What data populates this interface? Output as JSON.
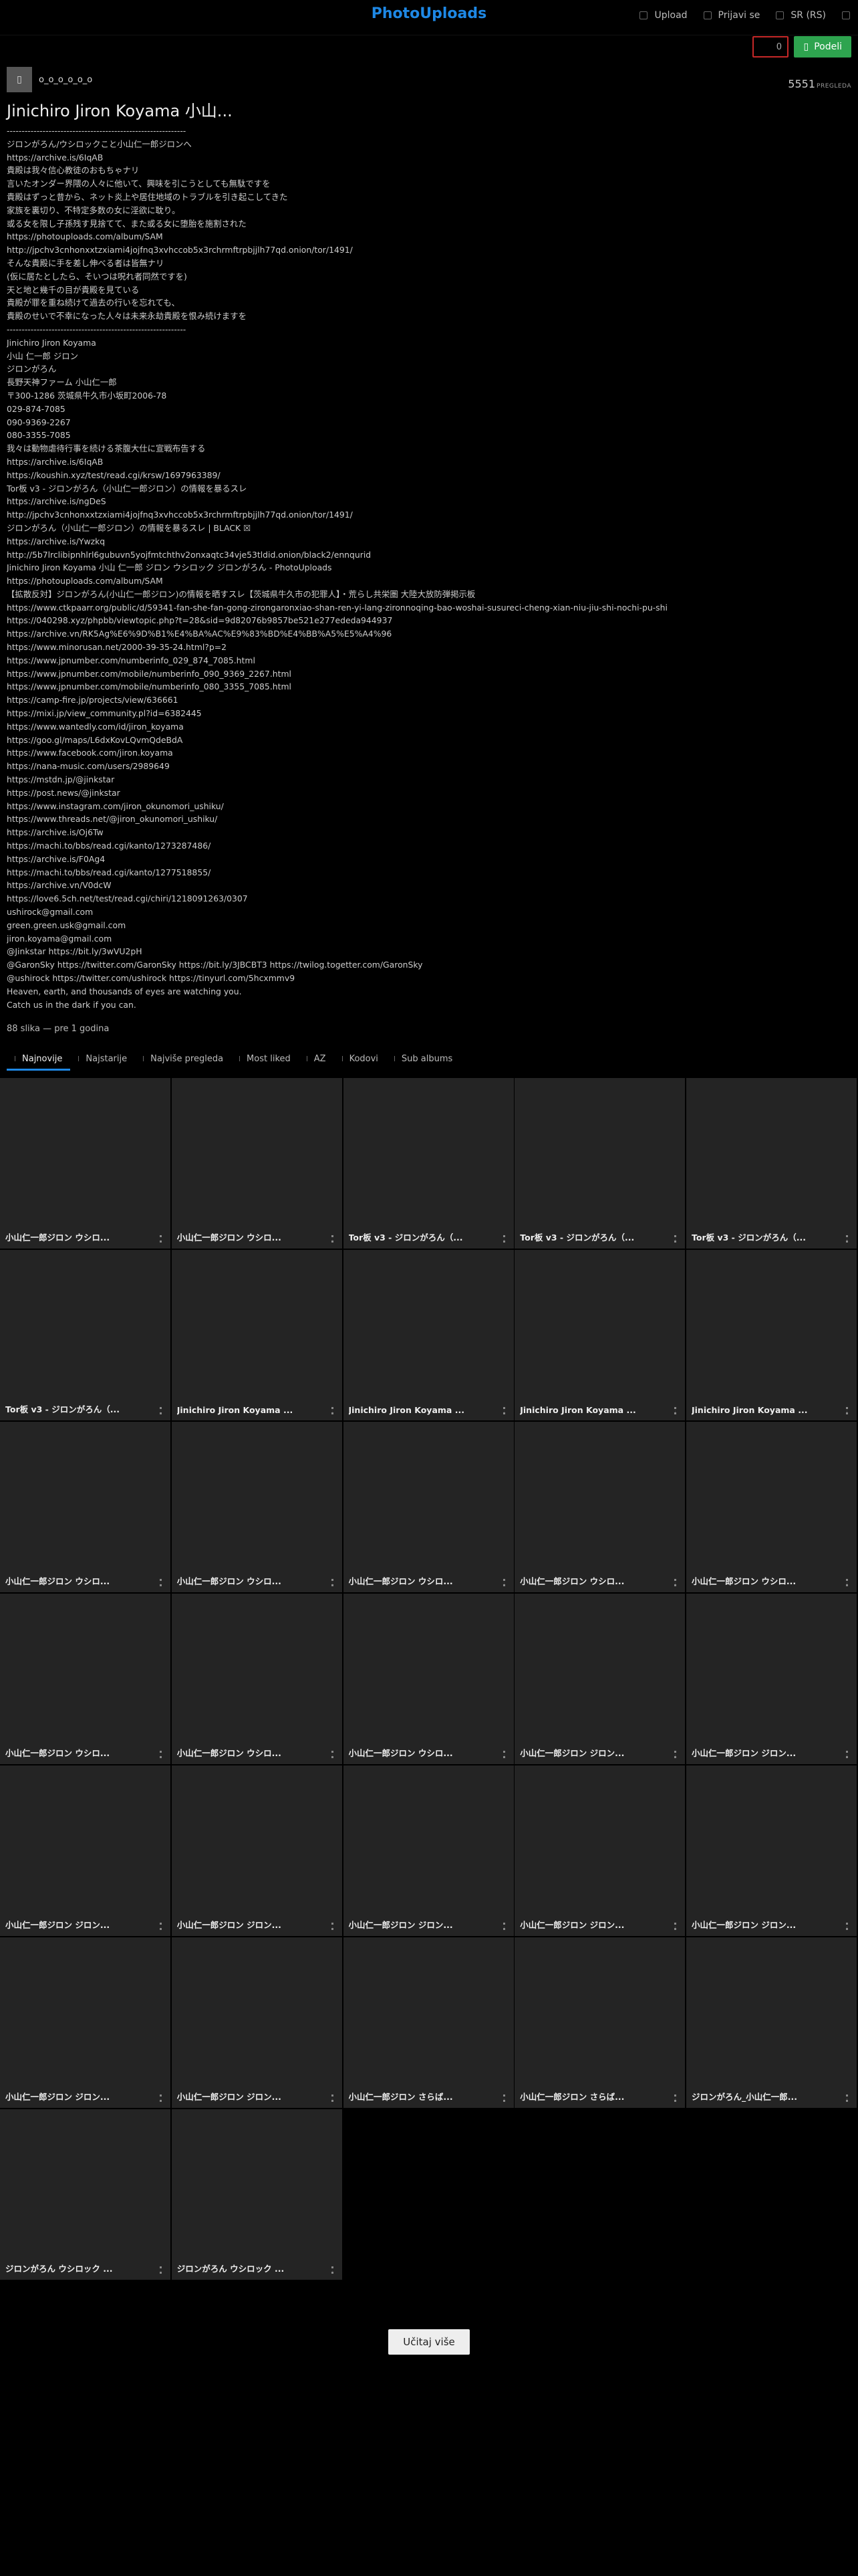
{
  "header": {
    "logo": "PhotoUploads",
    "upload_label": "Upload",
    "login_label": "Prijavi se",
    "language_label": "SR (RS)"
  },
  "actions": {
    "like_count": "0",
    "share_label": "Podeli"
  },
  "user": {
    "name": "ο_ο_ο_ο_ο_ο"
  },
  "album": {
    "title": "Jinichiro Jiron Koyama 小山...",
    "views": "5551",
    "views_label": "PREGLEDA",
    "meta": "88 slika — pre 1 godina"
  },
  "description_lines": [
    "------------------------------------------------------------",
    "ジロンがろん/ウシロックこと小山仁一郎ジロンへ",
    "https://archive.is/6IqAB",
    "貴殿は我々信心教徒のおもちゃナリ",
    "言いたオンダー界隈の人々に他いて、興味を引こうとしても無駄ですを",
    "貴殿はずっと昔から、ネット炎上や居住地域のトラブルを引き起こしてきた",
    "家族を裏切り、不特定多数の女に淫欲に耽り。",
    "或る女を限し子孫残す見捨てて、また或る女に堕胎を施割された",
    "https://photouploads.com/album/SAM",
    "http://jpchv3cnhonxxtzxiami4jojfnq3xvhccob5x3rchrmftrpbjjlh77qd.onion/tor/1491/",
    "そんな貴殿に手を差し伸べる者は皆無ナリ",
    "(仮に居たとしたら、そいつは呪れ者同然ですを)",
    "天と地と幾千の目が貴殿を見ている",
    "貴殿が罪を重ね続けて過去の行いを忘れても、",
    "貴殿のせいで不幸になった人々は未来永劫貴殿を恨み続けますを",
    "------------------------------------------------------------",
    "Jinichiro Jiron Koyama",
    "小山 仁一郎 ジロン",
    "ジロンがろん",
    "長野天神ファーム 小山仁一郎",
    "〒300-1286 茨城県牛久市小坂町2006-78",
    "029-874-7085",
    "090-9369-2267",
    "080-3355-7085",
    "我々は動物虐待行事を続ける茶腹大仕に宣戦布告する",
    "https://archive.is/6IqAB",
    "https://koushin.xyz/test/read.cgi/krsw/1697963389/",
    "Tor板 v3 - ジロンがろん（小山仁一郎ジロン）の情報を暴るスレ",
    "https://archive.is/ngDeS",
    "http://jpchv3cnhonxxtzxiami4jojfnq3xvhccob5x3rchrmftrpbjjlh77qd.onion/tor/1491/",
    "ジロンがろん（小山仁一郎ジロン）の情報を暴るスレ | BLACK ☒",
    "https://archive.is/Ywzkq",
    "http://5b7lrclibipnhlrl6gubuvn5yojfmtchthv2onxaqtc34vje53tldid.onion/black2/ennqurid",
    "Jinichiro Jiron Koyama 小山 仁一郎 ジロン ウシロック ジロンがろん - PhotoUploads",
    "https://photouploads.com/album/SAM",
    "【拡散反対】ジロンがろん(小山仁一郎ジロン)の情報を晒すスレ【茨城県牛久市の犯罪人】・荒らし共栄圏 大陸大放防弾掲示板",
    "https://www.ctkpaarr.org/public/d/59341-fan-she-fan-gong-zirongaronxiao-shan-ren-yi-lang-zironnoqing-bao-woshai-susureci-cheng-xian-niu-jiu-shi-nochi-pu-shi",
    "https://040298.xyz/phpbb/viewtopic.php?t=28&sid=9d82076b9857be521e277ededa944937",
    "https://archive.vn/RK5Ag%E6%9D%B1%E4%BA%AC%E9%83%BD%E4%BB%A5%E5%A4%96",
    "https://www.minorusan.net/2000-39-35-24.html?p=2",
    "https://www.jpnumber.com/numberinfo_029_874_7085.html",
    "https://www.jpnumber.com/mobile/numberinfo_090_9369_2267.html",
    "https://www.jpnumber.com/mobile/numberinfo_080_3355_7085.html",
    "https://camp-fire.jp/projects/view/636661",
    "https://mixi.jp/view_community.pl?id=6382445",
    "https://www.wantedly.com/id/jiron_koyama",
    "https://goo.gl/maps/L6dxKovLQvmQdeBdA",
    "https://www.facebook.com/jiron.koyama",
    "https://nana-music.com/users/2989649",
    "https://mstdn.jp/@jinkstar",
    "https://post.news/@jinkstar",
    "https://www.instagram.com/jiron_okunomori_ushiku/",
    "https://www.threads.net/@jiron_okunomori_ushiku/",
    "https://archive.is/Oj6Tw",
    "https://machi.to/bbs/read.cgi/kanto/1273287486/",
    "https://archive.is/F0Ag4",
    "https://machi.to/bbs/read.cgi/kanto/1277518855/",
    "https://archive.vn/V0dcW",
    "https://love6.5ch.net/test/read.cgi/chiri/1218091263/0307",
    "ushirock@gmail.com",
    "green.green.usk@gmail.com",
    "jiron.koyama@gmail.com",
    "@Jinkstar https://bit.ly/3wVU2pH",
    "@GaronSky https://twitter.com/GaronSky https://bit.ly/3JBCBT3 https://twilog.togetter.com/GaronSky",
    "@ushirock https://twitter.com/ushirock https://tinyurl.com/5hcxmmv9",
    "Heaven, earth, and thousands of eyes are watching you.",
    "Catch us in the dark if you can."
  ],
  "tabs": [
    {
      "label": "Najnovije",
      "active": true
    },
    {
      "label": "Najstarije",
      "active": false
    },
    {
      "label": "Najviše pregleda",
      "active": false
    },
    {
      "label": "Most liked",
      "active": false
    },
    {
      "label": "AZ",
      "active": false
    },
    {
      "label": "Kodovi",
      "active": false
    },
    {
      "label": "Sub albums",
      "active": false
    }
  ],
  "images": [
    "小山仁一郎ジロン ウシロ...",
    "小山仁一郎ジロン ウシロ...",
    "Tor板 v3 - ジロンがろん（...",
    "Tor板 v3 - ジロンがろん（...",
    "Tor板 v3 - ジロンがろん（...",
    "Tor板 v3 - ジロンがろん（...",
    "Jinichiro Jiron Koyama ...",
    "Jinichiro Jiron Koyama ...",
    "Jinichiro Jiron Koyama ...",
    "Jinichiro Jiron Koyama ...",
    "小山仁一郎ジロン ウシロ...",
    "小山仁一郎ジロン ウシロ...",
    "小山仁一郎ジロン ウシロ...",
    "小山仁一郎ジロン ウシロ...",
    "小山仁一郎ジロン ウシロ...",
    "小山仁一郎ジロン ウシロ...",
    "小山仁一郎ジロン ウシロ...",
    "小山仁一郎ジロン ウシロ...",
    "小山仁一郎ジロン ジロン...",
    "小山仁一郎ジロン ジロン...",
    "小山仁一郎ジロン ジロン...",
    "小山仁一郎ジロン ジロン...",
    "小山仁一郎ジロン ジロン...",
    "小山仁一郎ジロン ジロン...",
    "小山仁一郎ジロン ジロン...",
    "小山仁一郎ジロン ジロン...",
    "小山仁一郎ジロン ジロン...",
    "小山仁一郎ジロン さらば...",
    "小山仁一郎ジロン さらば...",
    "ジロンがろん_小山仁一郎...",
    "ジロンがろん ウシロック ...",
    "ジロンがろん ウシロック ..."
  ],
  "load_more_label": "Učitaj više"
}
